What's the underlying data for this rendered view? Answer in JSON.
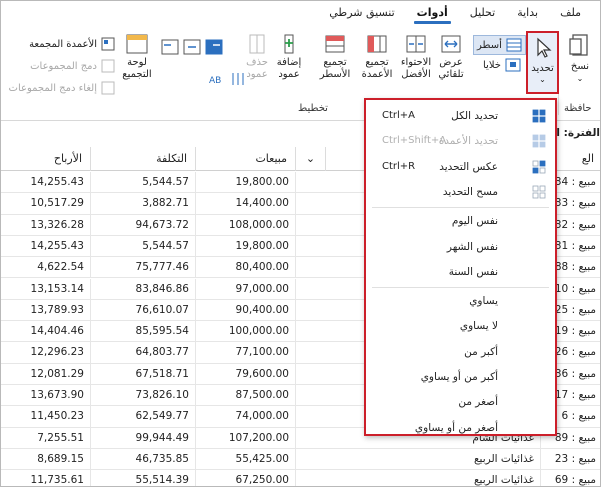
{
  "tabs": [
    {
      "label": "ملف",
      "active": false
    },
    {
      "label": "بداية",
      "active": false
    },
    {
      "label": "تحليل",
      "active": false
    },
    {
      "label": "أدوات",
      "active": true
    },
    {
      "label": "تنسيق شرطي",
      "active": false
    }
  ],
  "ribbon": {
    "paste": "نسخ",
    "clipboard_group": "حافظة",
    "select": "تحديد",
    "rows": "أسطر",
    "cells": "خلايا",
    "auto_fit": "عرض تلقائي",
    "best_fit": "الاحتواء الأفضل",
    "group_columns": "تجميع الأعمدة",
    "group_rows": "تجميع الأسطر",
    "add_column": "إضافة عمود",
    "delete_column": "حذف عمود",
    "layout_group": "تخطيط",
    "group_panel": "لوحة التجميع",
    "grouped_columns": "الأعمدة المجمعة",
    "merge_groups": "دمج المجموعات",
    "unmerge_groups": "إلغاء دمج المجموعات"
  },
  "filterbar": {
    "period": "الفترة: اعت"
  },
  "table": {
    "headers": [
      "الأرباح",
      "التكلفة",
      "مبيعات",
      "",
      "الع"
    ],
    "rows": [
      {
        "profit": "14,255.43",
        "cost": "5,544.57",
        "sales": "19,800.00",
        "label": "مبيع : 34",
        "ext": ""
      },
      {
        "profit": "10,517.29",
        "cost": "3,882.71",
        "sales": "14,400.00",
        "label": "مبيع : 33",
        "ext": ""
      },
      {
        "profit": "13,326.28",
        "cost": "94,673.72",
        "sales": "108,000.00",
        "label": "مبيع : 32",
        "ext": ""
      },
      {
        "profit": "14,255.43",
        "cost": "5,544.57",
        "sales": "19,800.00",
        "label": "مبيع : 31",
        "ext": ""
      },
      {
        "profit": "4,622.54",
        "cost": "75,777.46",
        "sales": "80,400.00",
        "label": "مبيع : 88",
        "ext": ""
      },
      {
        "profit": "13,153.14",
        "cost": "83,846.86",
        "sales": "97,000.00",
        "label": "مبيع : 10",
        "ext": ""
      },
      {
        "profit": "13,789.93",
        "cost": "76,610.07",
        "sales": "90,400.00",
        "label": "مبيع : 25",
        "ext": ""
      },
      {
        "profit": "14,404.46",
        "cost": "85,595.54",
        "sales": "100,000.00",
        "label": "مبيع : 19",
        "ext": ""
      },
      {
        "profit": "12,296.23",
        "cost": "64,803.77",
        "sales": "77,100.00",
        "label": "مبيع : 26",
        "ext": ""
      },
      {
        "profit": "12,081.29",
        "cost": "67,518.71",
        "sales": "79,600.00",
        "label": "مبيع : 36",
        "ext": ""
      },
      {
        "profit": "13,673.90",
        "cost": "73,826.10",
        "sales": "87,500.00",
        "label": "مبيع : 17",
        "ext": ""
      },
      {
        "profit": "11,450.23",
        "cost": "62,549.77",
        "sales": "74,000.00",
        "label": "مبيع : 6",
        "ext": ""
      },
      {
        "profit": "7,255.51",
        "cost": "99,944.49",
        "sales": "107,200.00",
        "label": "مبيع : 89",
        "ext": "غذائيات الشام"
      },
      {
        "profit": "8,689.15",
        "cost": "46,735.85",
        "sales": "55,425.00",
        "label": "مبيع : 23",
        "ext": "غذائيات الربيع"
      },
      {
        "profit": "11,735.61",
        "cost": "55,514.39",
        "sales": "67,250.00",
        "label": "مبيع : 69",
        "ext": "غذائيات الربيع"
      }
    ]
  },
  "menu": {
    "items": [
      {
        "label": "تحديد الكل",
        "shortcut": "Ctrl+A",
        "icon": "select-all-icon",
        "disabled": false
      },
      {
        "label": "تحديد الأعمدة",
        "shortcut": "Ctrl+Shift+A",
        "icon": "select-columns-icon",
        "disabled": true
      },
      {
        "label": "عكس التحديد",
        "shortcut": "Ctrl+R",
        "icon": "invert-selection-icon",
        "disabled": false
      },
      {
        "label": "مسح التحديد",
        "shortcut": "",
        "icon": "clear-selection-icon",
        "disabled": false
      },
      {
        "label": "نفس اليوم",
        "shortcut": "",
        "icon": "",
        "disabled": false
      },
      {
        "label": "نفس الشهر",
        "shortcut": "",
        "icon": "",
        "disabled": false
      },
      {
        "label": "نفس السنة",
        "shortcut": "",
        "icon": "",
        "disabled": false
      },
      {
        "label": "يساوي",
        "shortcut": "",
        "icon": "",
        "disabled": false
      },
      {
        "label": "لا يساوي",
        "shortcut": "",
        "icon": "",
        "disabled": false
      },
      {
        "label": "أكبر من",
        "shortcut": "",
        "icon": "",
        "disabled": false
      },
      {
        "label": "أكبر من أو يساوي",
        "shortcut": "",
        "icon": "",
        "disabled": false
      },
      {
        "label": "أصغر من",
        "shortcut": "",
        "icon": "",
        "disabled": false
      },
      {
        "label": "أصغر من أو يساوي",
        "shortcut": "",
        "icon": "",
        "disabled": false
      }
    ]
  },
  "colors": {
    "accent": "#2b6fbf",
    "highlight": "#cc1f2a"
  }
}
